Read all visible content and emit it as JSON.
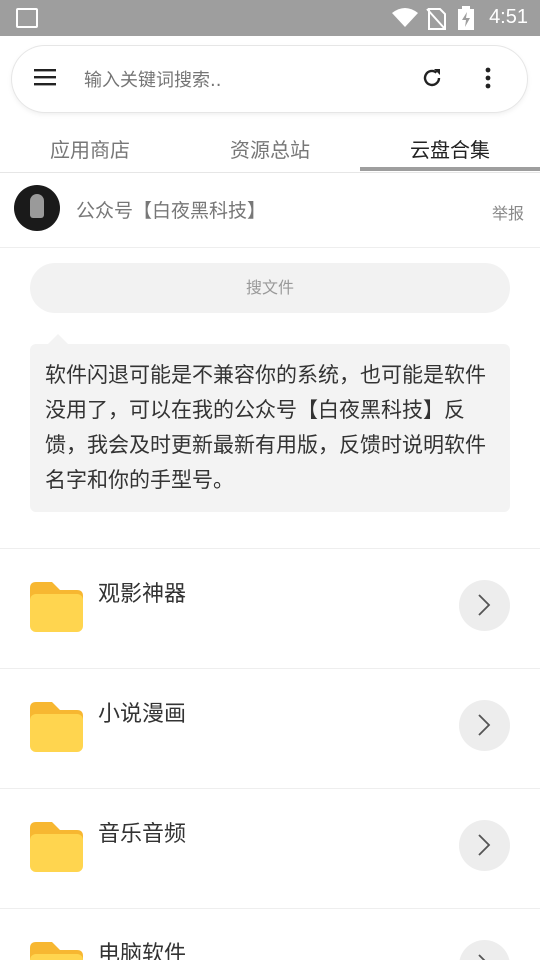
{
  "status_bar": {
    "time": "4:51",
    "icons": [
      "image-icon",
      "wifi-icon",
      "no-sim-icon",
      "battery-charging-icon"
    ]
  },
  "search": {
    "placeholder": "输入关键词搜索.."
  },
  "tabs": [
    {
      "label": "应用商店",
      "active": false
    },
    {
      "label": "资源总站",
      "active": false
    },
    {
      "label": "云盘合集",
      "active": true
    }
  ],
  "account": {
    "name": "公众号【白夜黑科技】",
    "report_label": "举报"
  },
  "search_file_label": "搜文件",
  "notice": "软件闪退可能是不兼容你的系统，也可能是软件没用了，可以在我的公众号【白夜黑科技】反馈，我会及时更新最新有用版，反馈时说明软件名字和你的手型号。",
  "folders": [
    {
      "title": "观影神器"
    },
    {
      "title": "小说漫画"
    },
    {
      "title": "音乐音频"
    },
    {
      "title": "电脑软件"
    }
  ],
  "colors": {
    "status_bar": "#9e9e9e",
    "folder": "#ffd54f",
    "folder_tab": "#f7b731"
  }
}
